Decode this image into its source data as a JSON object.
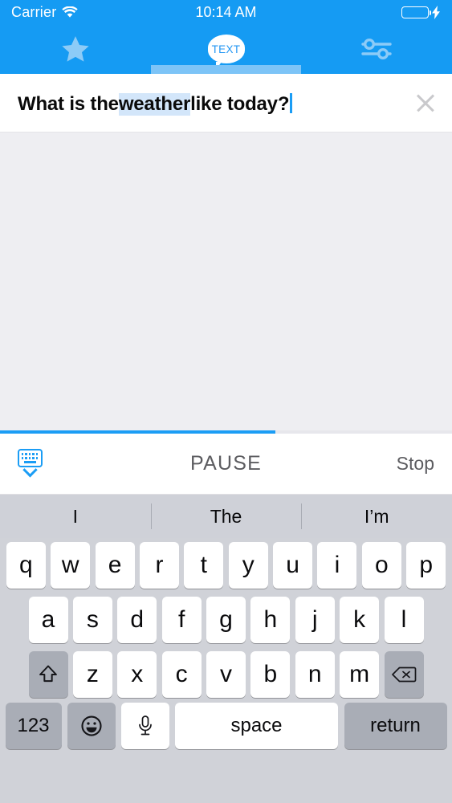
{
  "status_bar": {
    "carrier": "Carrier",
    "wifi_icon": "wifi-icon",
    "time": "10:14 AM",
    "battery_icon": "battery-icon",
    "charging_icon": "lightning-bolt-icon",
    "battery_color": "#4cd364"
  },
  "nav": {
    "background_color": "#159bf3",
    "tabs": [
      {
        "name": "favorites",
        "icon": "star-icon",
        "active": false
      },
      {
        "name": "text",
        "icon": "speech-bubble-icon",
        "label": "TEXT",
        "active": true
      },
      {
        "name": "settings",
        "icon": "sliders-icon",
        "active": false
      }
    ],
    "indicator_color": "#7dc4f7"
  },
  "text_field": {
    "segments": [
      {
        "text": "What is the ",
        "highlighted": false
      },
      {
        "text": "weather",
        "highlighted": true
      },
      {
        "text": " like today?",
        "highlighted": false
      }
    ],
    "full_text": "What is the weather like today?",
    "highlight_color": "#d3e6fa",
    "caret_color": "#1b9df5",
    "clear_icon": "close-x-icon"
  },
  "content": {
    "background_color": "#eeeef2"
  },
  "progress": {
    "percent": 61,
    "fill_color": "#1b9df5",
    "track_color": "#e7e7ec"
  },
  "controls": {
    "keyboard_dismiss_icon": "keyboard-dismiss-icon",
    "pause_label": "PAUSE",
    "stop_label": "Stop"
  },
  "keyboard": {
    "background_color": "#d0d2d8",
    "predictions": [
      "I",
      "The",
      "I’m"
    ],
    "row1": [
      "q",
      "w",
      "e",
      "r",
      "t",
      "y",
      "u",
      "i",
      "o",
      "p"
    ],
    "row2": [
      "a",
      "s",
      "d",
      "f",
      "g",
      "h",
      "j",
      "k",
      "l"
    ],
    "row3": [
      "z",
      "x",
      "c",
      "v",
      "b",
      "n",
      "m"
    ],
    "shift_icon": "shift-arrow-icon",
    "delete_icon": "backspace-icon",
    "numbers_label": "123",
    "emoji_icon": "emoji-smiley-icon",
    "dictation_icon": "microphone-icon",
    "space_label": "space",
    "return_label": "return"
  }
}
